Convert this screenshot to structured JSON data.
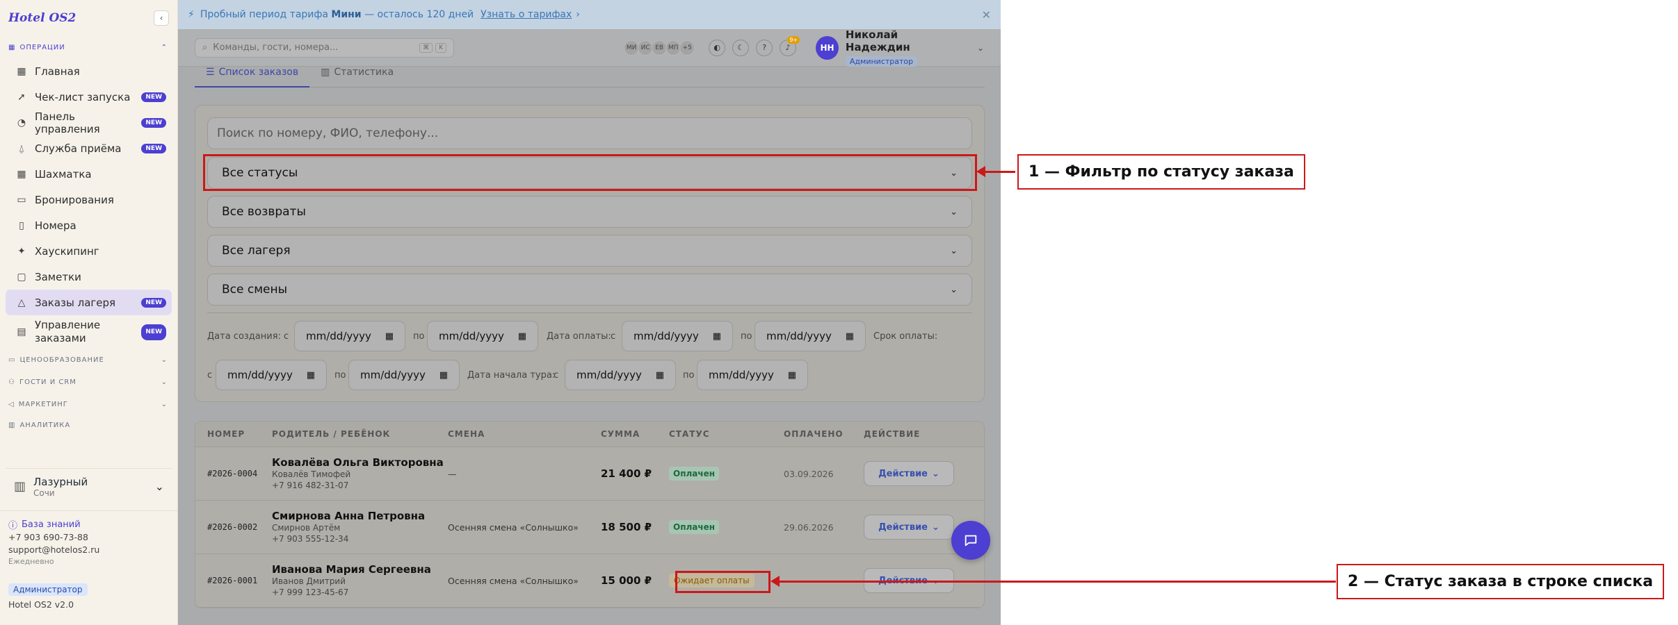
{
  "sidebar": {
    "logo": "Hotel OS2",
    "collapse_icon": "‹",
    "section_operations": "ОПЕРАЦИИ",
    "items": [
      {
        "label": "Главная",
        "icon": "grid-icon",
        "badge": ""
      },
      {
        "label": "Чек-лист запуска",
        "icon": "rocket-icon",
        "badge": "NEW"
      },
      {
        "label": "Панель управления",
        "icon": "gauge-icon",
        "badge": "NEW"
      },
      {
        "label": "Служба приёма",
        "icon": "bell-icon",
        "badge": "NEW"
      },
      {
        "label": "Шахматка",
        "icon": "table-icon",
        "badge": ""
      },
      {
        "label": "Бронирования",
        "icon": "book-icon",
        "badge": ""
      },
      {
        "label": "Номера",
        "icon": "door-icon",
        "badge": ""
      },
      {
        "label": "Хаускипинг",
        "icon": "sparkle-icon",
        "badge": ""
      },
      {
        "label": "Заметки",
        "icon": "note-icon",
        "badge": ""
      },
      {
        "label": "Заказы лагеря",
        "icon": "tent-icon",
        "badge": "NEW"
      },
      {
        "label": "Управление заказами",
        "icon": "clipboard-icon",
        "badge": "NEW"
      }
    ],
    "sections_collapsed": [
      {
        "label": "ЦЕНООБРАЗОВАНИЕ"
      },
      {
        "label": "ГОСТИ И CRM"
      },
      {
        "label": "МАРКЕТИНГ"
      },
      {
        "label": "АНАЛИТИКА"
      }
    ],
    "hotel": {
      "name": "Лазурный",
      "city": "Сочи"
    },
    "footer": {
      "knowledge_base": "База знаний",
      "phone": "+7 903 690-73-88",
      "email": "support@hotelos2.ru",
      "schedule": "Ежедневно",
      "role": "Администратор",
      "version": "Hotel OS2 v2.0"
    }
  },
  "banner": {
    "text_before": "Пробный период тарифа",
    "plan": "Мини",
    "text_after": "— осталось 120 дней",
    "link": "Узнать о тарифах",
    "link_arrow": "›",
    "close": "✕"
  },
  "topbar": {
    "search_placeholder": "Команды, гости, номера...",
    "kbd1": "⌘",
    "kbd2": "K",
    "avatars": [
      "МИ",
      "ИС",
      "ЕВ",
      "МП",
      "+5"
    ],
    "notifications": "9+",
    "user": {
      "initials": "НН",
      "name": "Николай Надеждин",
      "role": "Администратор"
    }
  },
  "tabs": [
    {
      "label": "Список заказов",
      "icon": "list-icon"
    },
    {
      "label": "Статистика",
      "icon": "bar-chart-icon"
    }
  ],
  "filters": {
    "search_placeholder": "Поиск по номеру, ФИО, телефону...",
    "status": "Все статусы",
    "returns": "Все возвраты",
    "camps": "Все лагеря",
    "shifts": "Все смены",
    "date_placeholder": "mm/dd/yyyy",
    "created_label": "Дата создания:",
    "paid_label": "Дата оплаты:",
    "due_label": "Срок оплаты:",
    "tour_label": "Дата начала тура:",
    "from": "с",
    "to": "по"
  },
  "table": {
    "headers": [
      "НОМЕР",
      "РОДИТЕЛЬ / РЕБЁНОК",
      "СМЕНА",
      "СУММА",
      "СТАТУС",
      "ОПЛАЧЕНО",
      "ДЕЙСТВИЕ"
    ],
    "rows": [
      {
        "number": "#2026-0004",
        "parent": "Ковалёва Ольга Викторовна",
        "child": "Ковалёв Тимофей",
        "phone": "+7 916 482-31-07",
        "shift": "—",
        "sum": "21 400 ₽",
        "status": "Оплачен",
        "paid": "03.09.2026",
        "action": "Действие"
      },
      {
        "number": "#2026-0002",
        "parent": "Смирнова Анна Петровна",
        "child": "Смирнов Артём",
        "phone": "+7 903 555-12-34",
        "shift": "Осенняя смена «Солнышко»",
        "sum": "18 500 ₽",
        "status": "Оплачен",
        "paid": "29.06.2026",
        "action": "Действие"
      },
      {
        "number": "#2026-0001",
        "parent": "Иванова Мария Сергеевна",
        "child": "Иванов Дмитрий",
        "phone": "+7 999 123-45-67",
        "shift": "Осенняя смена «Солнышко»",
        "sum": "15 000 ₽",
        "status": "Ожидает оплаты",
        "paid": "",
        "action": "Действие"
      }
    ]
  },
  "annotations": {
    "one": "1 — Фильтр по статусу заказа",
    "two": "2 — Статус заказа в строке списка"
  },
  "colors": {
    "accent": "#4c3fd1",
    "annotation": "#cc1818",
    "overlay": "#a9abad"
  }
}
